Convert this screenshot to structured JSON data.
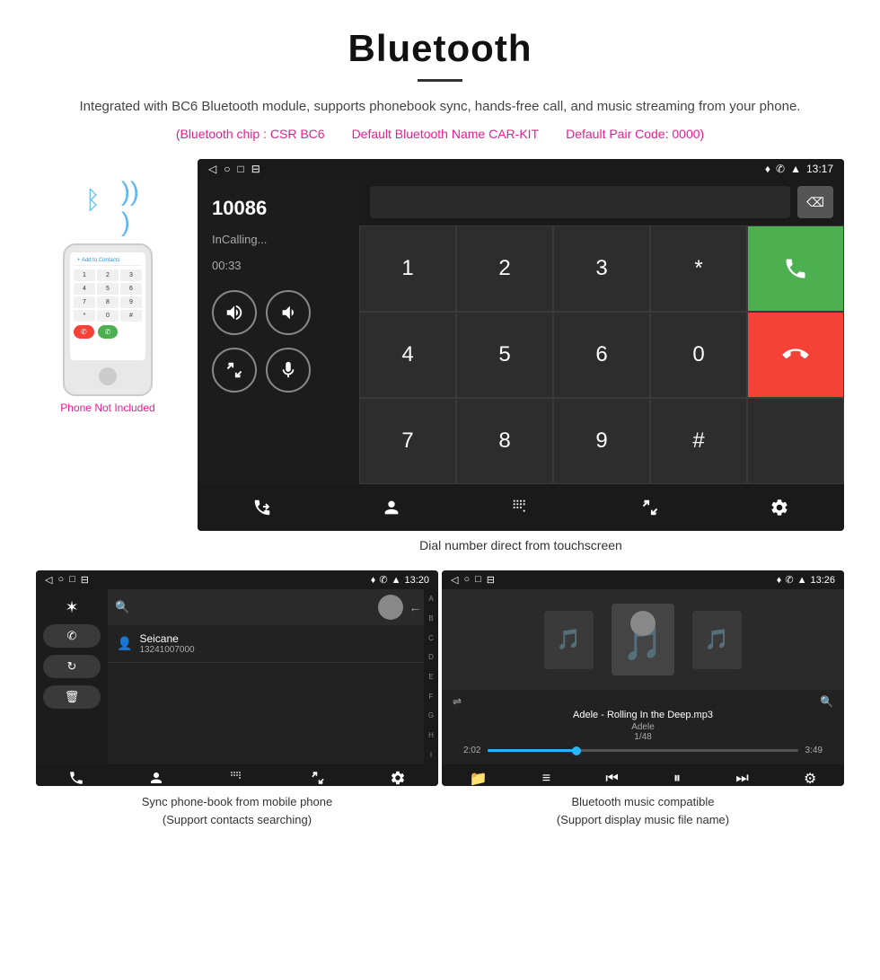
{
  "header": {
    "title": "Bluetooth",
    "description": "Integrated with BC6 Bluetooth module, supports phonebook sync, hands-free call, and music streaming from your phone.",
    "specs": [
      "(Bluetooth chip : CSR BC6",
      "Default Bluetooth Name CAR-KIT",
      "Default Pair Code: 0000)"
    ]
  },
  "phone_illustration": {
    "not_included": "Phone Not Included",
    "add_contact": "+ Add to Contacts",
    "keys": [
      "1",
      "2",
      "3",
      "4",
      "5",
      "6",
      "7",
      "8",
      "9",
      "*",
      "0",
      "#"
    ]
  },
  "main_screen": {
    "status_bar": {
      "time": "13:17",
      "nav_icons": [
        "◁",
        "○",
        "□",
        "⊟"
      ]
    },
    "call": {
      "number": "10086",
      "status": "InCalling...",
      "timer": "00:33"
    },
    "dialpad_keys": [
      "1",
      "2",
      "3",
      "*",
      "4",
      "5",
      "6",
      "0",
      "7",
      "8",
      "9",
      "#"
    ],
    "caption": "Dial number direct from touchscreen"
  },
  "phonebook_screen": {
    "status_bar": {
      "time": "13:20"
    },
    "contact": {
      "name": "Seicane",
      "number": "13241007000"
    },
    "alphabet": [
      "A",
      "B",
      "C",
      "D",
      "E",
      "F",
      "G",
      "H",
      "I"
    ],
    "caption_line1": "Sync phone-book from mobile phone",
    "caption_line2": "(Support contacts searching)"
  },
  "music_screen": {
    "status_bar": {
      "time": "13:26"
    },
    "song": {
      "title": "Adele - Rolling In the Deep.mp3",
      "artist": "Adele",
      "track_info": "1/48"
    },
    "progress": {
      "current": "2:02",
      "total": "3:49"
    },
    "caption_line1": "Bluetooth music compatible",
    "caption_line2": "(Support display music file name)"
  },
  "icons": {
    "bluetooth": "⊹",
    "back_arrow": "◁",
    "home": "○",
    "recent": "□",
    "phone_call": "📞",
    "volume_up": "🔊",
    "volume_down": "🔉",
    "transfer": "⇄",
    "mic": "🎤",
    "search": "🔍",
    "shuffle": "⇌",
    "prev": "⏮",
    "play_pause": "⏸",
    "next": "⏭",
    "equalizer": "⚙",
    "contacts_icon": "👤",
    "keypad_icon": "⊞",
    "settings_icon": "⚙",
    "bt_icon": "✶",
    "folder_icon": "📁",
    "list_icon": "≡"
  }
}
